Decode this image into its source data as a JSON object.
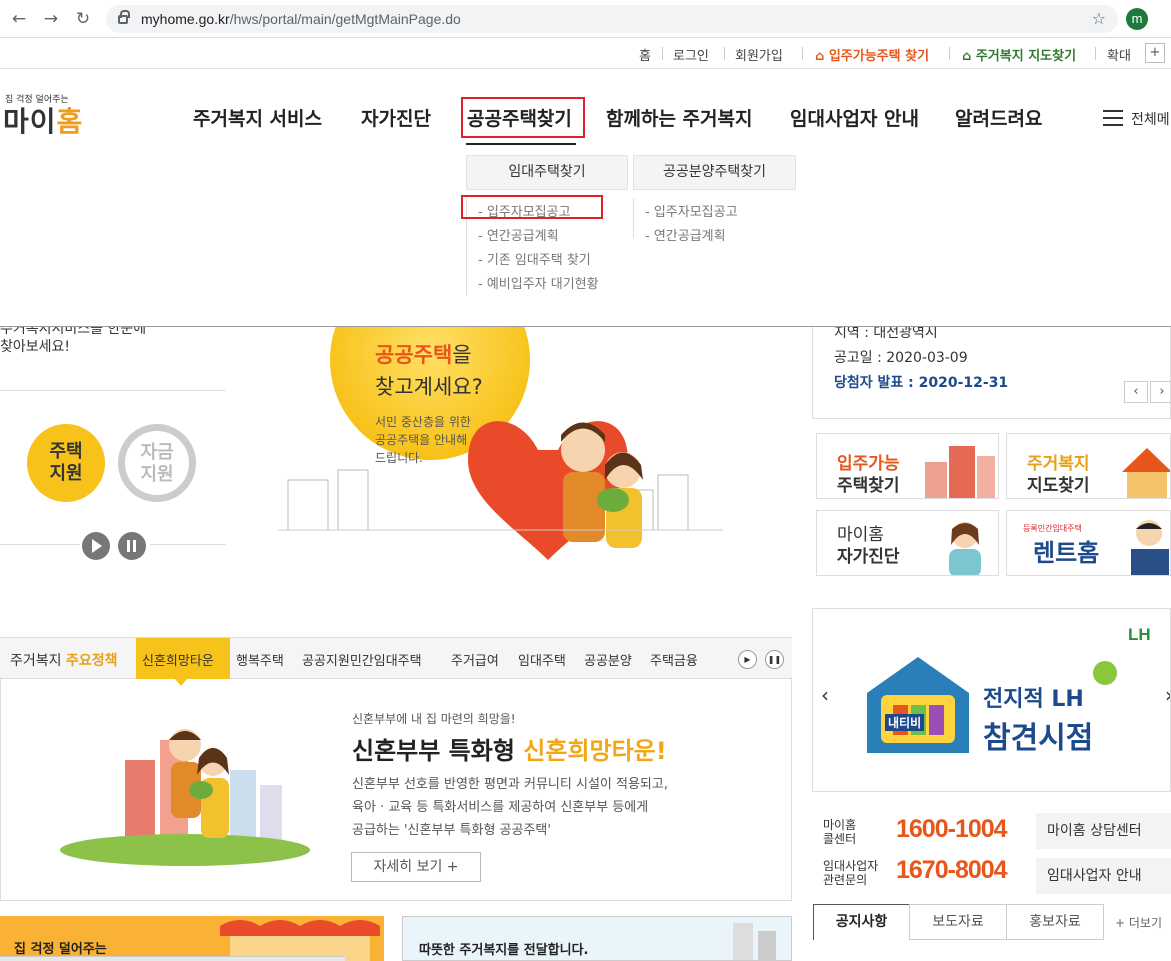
{
  "browser": {
    "url_host": "myhome.go.kr",
    "url_path": "/hws/portal/main/getMgtMainPage.do",
    "profile_initial": "m"
  },
  "util_nav": {
    "home": "홈",
    "login": "로그인",
    "join": "회원가입",
    "find_available": "입주가능주택 찾기",
    "find_map": "주거복지 지도찾기",
    "zoom": "확대"
  },
  "logo": {
    "tagline": "집 걱정 덜어주는",
    "name_a": "마이",
    "name_b": "홈"
  },
  "gnb": {
    "items": [
      "주거복지 서비스",
      "자가진단",
      "공공주택찾기",
      "함께하는 주거복지",
      "임대사업자 안내",
      "알려드려요"
    ],
    "all_menu": "전체메"
  },
  "dropdown": {
    "tab1": "임대주택찾기",
    "tab2": "공공분양주택찾기",
    "col1": [
      "- 입주자모집공고",
      "- 연간공급계획",
      "- 기존 임대주택 찾기",
      "- 예비입주자 대기현황"
    ],
    "col2": [
      "- 입주자모집공고",
      "- 연간공급계획"
    ]
  },
  "hero": {
    "left_text_1": "주거복지서비스를 한눈에",
    "left_text_2": "찾아보세요!",
    "headline_1": "공공주택",
    "headline_1_suffix": "을",
    "headline_2": "찾고계세요?",
    "sub_1": "서민 중산층을 위한",
    "sub_2": "공공주택을 안내해",
    "sub_3": "드립니다.",
    "circle_1": [
      "주택",
      "지원"
    ],
    "circle_2": [
      "자금",
      "지원"
    ]
  },
  "notice_card": {
    "region": "지역 : 대전광역시",
    "date": "공고일 : 2020-03-09",
    "winner": "당첨자 발표 : 2020-12-31"
  },
  "quick": [
    {
      "l1": "입주가능",
      "l2": "주택찾기"
    },
    {
      "l1": "주거복지",
      "l2": "지도찾기"
    },
    {
      "l1": "마이홈",
      "l2": "자가진단"
    },
    {
      "l1": "등록민간임대주택",
      "l2": "렌트홈"
    }
  ],
  "policy": {
    "label_a": "주거복지 ",
    "label_b": "주요정책",
    "tabs": [
      "신혼희망타운",
      "행복주택",
      "공공지원민간임대주택",
      "주거급여",
      "임대주택",
      "공공분양",
      "주택금융"
    ],
    "pre": "신혼부부에 내 집 마련의 희망을!",
    "title_a": "신혼부부 특화형 ",
    "title_b": "신혼희망타운!",
    "desc_1": "신혼부부 선호를 반영한 평면과 커뮤니티 시설이 적용되고,",
    "desc_2": "육아 · 교육 등 특화서비스를 제공하여 신혼부부 등에게",
    "desc_3": "공급하는 '신혼부부 특화형 공공주택'",
    "more": "자세히 보기 +"
  },
  "banner": {
    "logo": "LH",
    "badge": "내티비",
    "line1": "전지적 LH",
    "line2": "참견시점"
  },
  "contacts": [
    {
      "l1": "마이홈",
      "l2": "콜센터",
      "num": "1600-1004",
      "btn": "마이홈 상담센터"
    },
    {
      "l1": "임대사업자",
      "l2": "관련문의",
      "num": "1670-8004",
      "btn": "임대사업자 안내"
    }
  ],
  "news_tabs": [
    "공지사항",
    "보도자료",
    "홍보자료"
  ],
  "news_more": "+ 더보기",
  "bottom": {
    "left": "집 걱정 덜어주는",
    "right": "따뜻한 주거복지를 전달합니다."
  },
  "colors": {
    "accent_orange": "#f29b1c",
    "highlight_red": "#e0202a",
    "brand_yellow": "#f7c21a",
    "phone_orange": "#e8561b",
    "link_blue": "#1d4a8c"
  }
}
